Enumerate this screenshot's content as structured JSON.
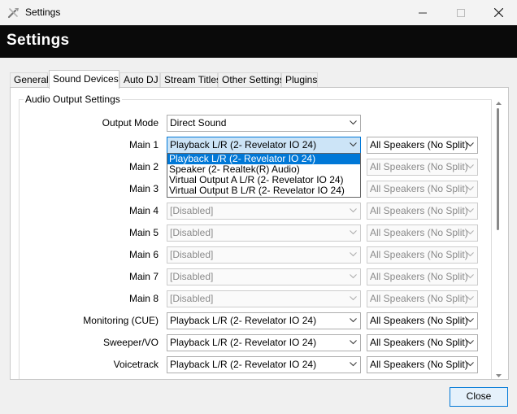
{
  "window": {
    "title": "Settings",
    "icons": {
      "app": "settings-wrench-icon",
      "minimize": "minimize-icon",
      "maximize": "maximize-icon",
      "close": "close-icon"
    }
  },
  "banner": {
    "heading": "Settings"
  },
  "tabs": [
    {
      "label": "General"
    },
    {
      "label": "Sound Devices"
    },
    {
      "label": "Auto DJ"
    },
    {
      "label": "Stream Titles"
    },
    {
      "label": "Other Settings"
    },
    {
      "label": "Plugins"
    }
  ],
  "active_tab": "Sound Devices",
  "group": {
    "title": "Audio Output Settings"
  },
  "rows": [
    {
      "label": "Output Mode",
      "device": "Direct Sound",
      "speakers": null,
      "disabled": false
    },
    {
      "label": "Main 1",
      "device": "Playback L/R (2- Revelator IO 24)",
      "speakers": "All Speakers (No Split)",
      "disabled": false
    },
    {
      "label": "Main 2",
      "device": "",
      "speakers": "All Speakers (No Split)",
      "disabled": true
    },
    {
      "label": "Main 3",
      "device": "",
      "speakers": "All Speakers (No Split)",
      "disabled": true
    },
    {
      "label": "Main 4",
      "device": "[Disabled]",
      "speakers": "All Speakers (No Split)",
      "disabled": true
    },
    {
      "label": "Main 5",
      "device": "[Disabled]",
      "speakers": "All Speakers (No Split)",
      "disabled": true
    },
    {
      "label": "Main 6",
      "device": "[Disabled]",
      "speakers": "All Speakers (No Split)",
      "disabled": true
    },
    {
      "label": "Main 7",
      "device": "[Disabled]",
      "speakers": "All Speakers (No Split)",
      "disabled": true
    },
    {
      "label": "Main 8",
      "device": "[Disabled]",
      "speakers": "All Speakers (No Split)",
      "disabled": true
    },
    {
      "label": "Monitoring (CUE)",
      "device": "Playback L/R (2- Revelator IO 24)",
      "speakers": "All Speakers (No Split)",
      "disabled": false
    },
    {
      "label": "Sweeper/VO",
      "device": "Playback L/R (2- Revelator IO 24)",
      "speakers": "All Speakers (No Split)",
      "disabled": false
    },
    {
      "label": "Voicetrack",
      "device": "Playback L/R (2- Revelator IO 24)",
      "speakers": "All Speakers (No Split)",
      "disabled": false
    }
  ],
  "dropdown": {
    "open_for": "Main 1",
    "options": [
      {
        "label": "Playback L/R (2- Revelator IO 24)",
        "selected": true
      },
      {
        "label": "Speaker (2- Realtek(R) Audio)",
        "selected": false
      },
      {
        "label": "Virtual Output A L/R (2- Revelator IO 24)",
        "selected": false
      },
      {
        "label": "Virtual Output B L/R (2- Revelator IO 24)",
        "selected": false
      }
    ]
  },
  "footer": {
    "close_label": "Close"
  },
  "colors": {
    "accent": "#0078d7",
    "banner_bg": "#0a0a0a",
    "selection": "#0078d7"
  }
}
